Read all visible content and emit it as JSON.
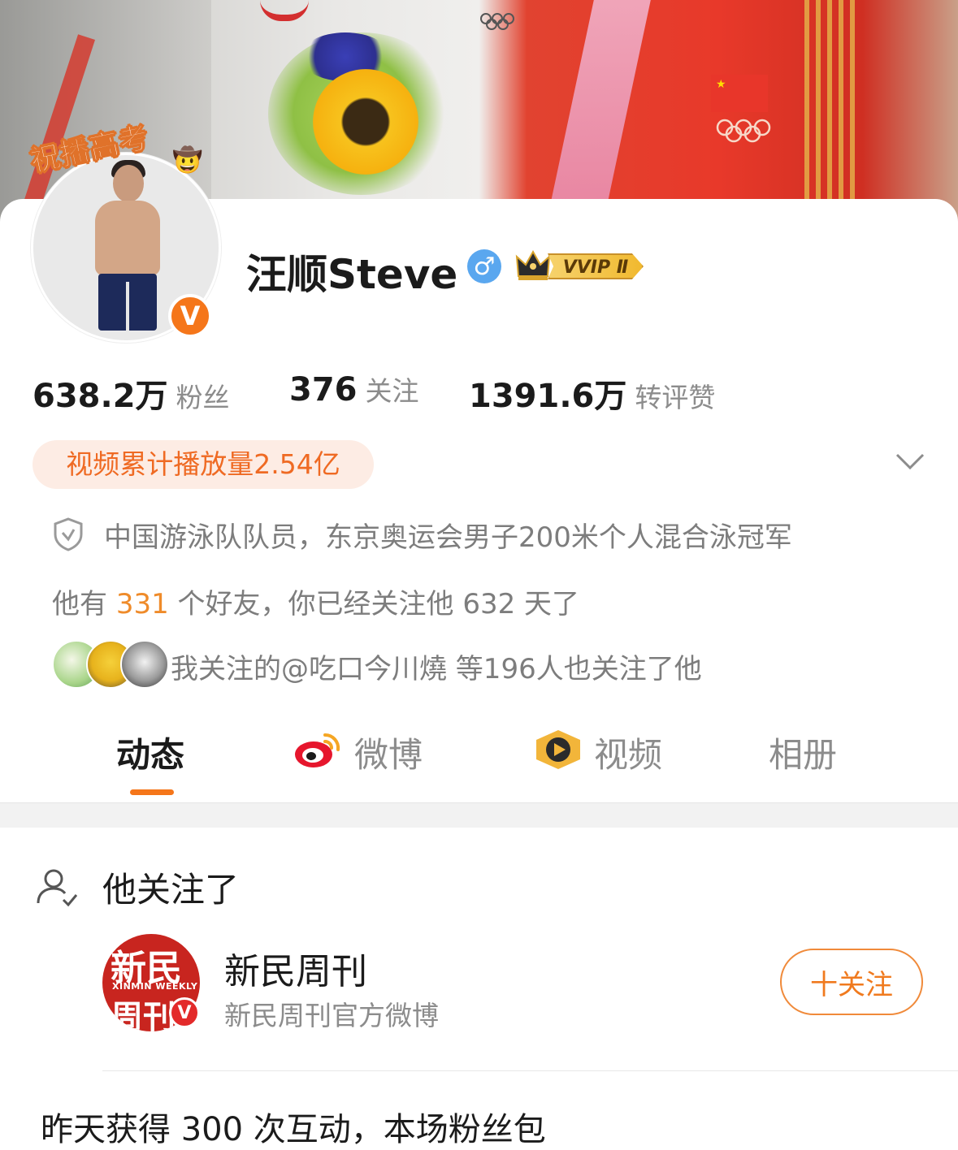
{
  "profile": {
    "avatar_ribbon": "祝播高考",
    "name": "汪顺Steve",
    "gender_symbol": "♂",
    "vip_label": "VVIP Ⅱ",
    "verified_badge": "V"
  },
  "stats": {
    "fans_count": "638.2万",
    "fans_label": "粉丝",
    "following_count": "376",
    "following_label": "关注",
    "interactions_count": "1391.6万",
    "interactions_label": "转评赞"
  },
  "video_pill": "视频累计播放量2.54亿",
  "certification": "中国游泳队队员，东京奥运会男子200米个人混合泳冠军",
  "friends": {
    "prefix": "他有 ",
    "count": "331",
    "suffix": " 个好友，你已经关注他 632 天了"
  },
  "mutual": "我关注的@吃口今川燒  等196人也关注了他",
  "tabs": [
    "动态",
    "微博",
    "视频",
    "相册"
  ],
  "follow_section": {
    "title": "他关注了",
    "account_name": "新民周刊",
    "account_desc": "新民周刊官方微博",
    "logo_top": "新民",
    "logo_mid": "XINMIN WEEKLY",
    "logo_bottom": "周刊",
    "button_label": "十关注"
  },
  "next_row": "昨天获得 300 次互动，本场粉丝包",
  "colors": {
    "accent": "#f5761a",
    "highlight": "#ef8b2a",
    "pill_bg": "#fdece4",
    "gender_blue": "#5aa7ef"
  }
}
